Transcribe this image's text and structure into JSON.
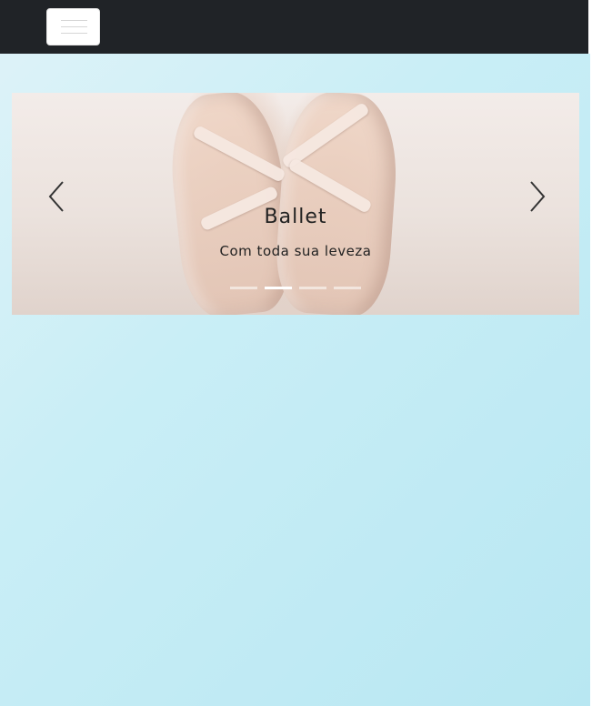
{
  "navbar": {
    "toggle_icon": "hamburger-menu-icon",
    "background": "#202327"
  },
  "carousel": {
    "slide_image": "ballet-pointe-shoes-photo",
    "caption_title": "Ballet",
    "caption_subtitle": "Com toda sua leveza",
    "prev_icon": "chevron-left-icon",
    "next_icon": "chevron-right-icon",
    "slide_count": 4,
    "active_index": 1
  },
  "colors": {
    "page_gradient_start": "#dff3f8",
    "page_gradient_end": "#b8e7f2",
    "caption_text": "#222222"
  }
}
